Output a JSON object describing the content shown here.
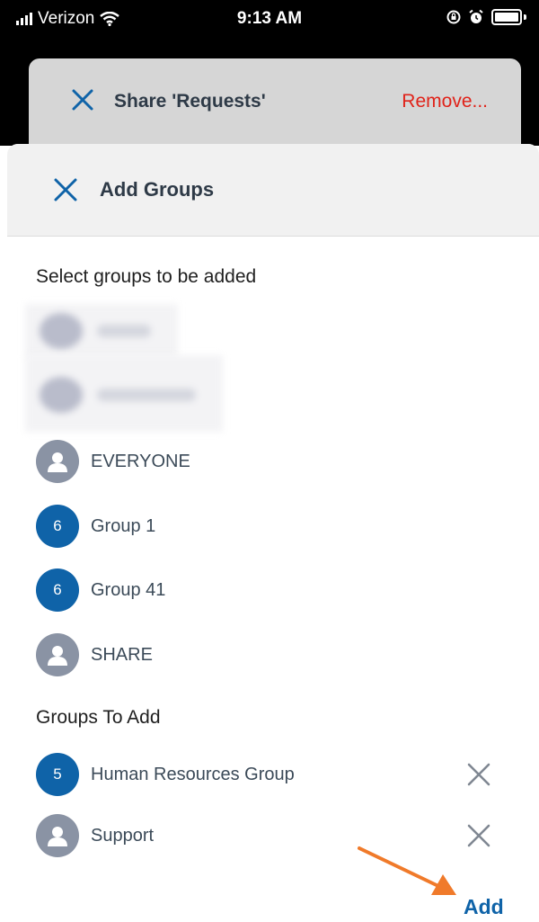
{
  "status_bar": {
    "carrier": "Verizon",
    "time": "9:13 AM"
  },
  "underlying_sheet": {
    "title": "Share 'Requests'",
    "remove_label": "Remove..."
  },
  "sheet": {
    "title": "Add Groups",
    "select_label": "Select groups to be added",
    "available_groups": [
      {
        "name": "EVERYONE",
        "badge": "",
        "avatar": "person-icon"
      },
      {
        "name": "Group 1",
        "badge": "6",
        "avatar": "count"
      },
      {
        "name": "Group 41",
        "badge": "6",
        "avatar": "count"
      },
      {
        "name": "SHARE",
        "badge": "",
        "avatar": "person-icon"
      }
    ],
    "to_add_label": "Groups To Add",
    "groups_to_add": [
      {
        "name": "Human Resources Group",
        "badge": "5",
        "avatar": "count"
      },
      {
        "name": "Support",
        "badge": "",
        "avatar": "person-icon"
      }
    ],
    "add_label": "Add"
  },
  "colors": {
    "accent": "#0f63a8",
    "remove": "#e0231a",
    "avatar_gray": "#8a93a4",
    "annotation_arrow": "#f07a2a"
  }
}
